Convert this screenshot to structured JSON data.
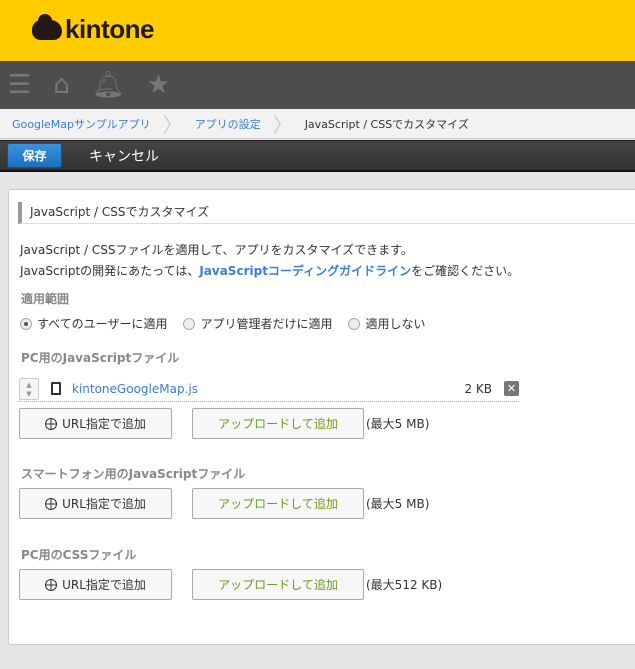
{
  "header": {
    "logo_text": "kintone"
  },
  "breadcrumb": [
    "GoogleMapサンプルアプリ",
    "アプリの設定",
    "JavaScript / CSSでカスタマイズ"
  ],
  "toolbar": {
    "save": "保存",
    "cancel": "キャンセル"
  },
  "panel": {
    "title": "JavaScript / CSSでカスタマイズ",
    "desc1": "JavaScript / CSSファイルを適用して、アプリをカスタマイズできます。",
    "desc2_pre": "JavaScriptの開発にあたっては、",
    "desc2_link": "JavaScriptコーディングガイドライン",
    "desc2_post": "をご確認ください。",
    "scope_label": "適用範囲",
    "scope_options": [
      "すべてのユーザーに適用",
      "アプリ管理者だけに適用",
      "適用しない"
    ],
    "scope_selected": 0,
    "sections": [
      {
        "heading": "PC用のJavaScriptファイル",
        "files": [
          {
            "name": "kintoneGoogleMap.js",
            "size": "2 KB"
          }
        ],
        "url_btn": "URL指定で追加",
        "upload_btn": "アップロードして追加",
        "max": "(最大5 MB)"
      },
      {
        "heading": "スマートフォン用のJavaScriptファイル",
        "url_btn": "URL指定で追加",
        "upload_btn": "アップロードして追加",
        "max": "(最大5 MB)"
      },
      {
        "heading": "PC用のCSSファイル",
        "url_btn": "URL指定で追加",
        "upload_btn": "アップロードして追加",
        "max": "(最大512 KB)"
      }
    ]
  }
}
